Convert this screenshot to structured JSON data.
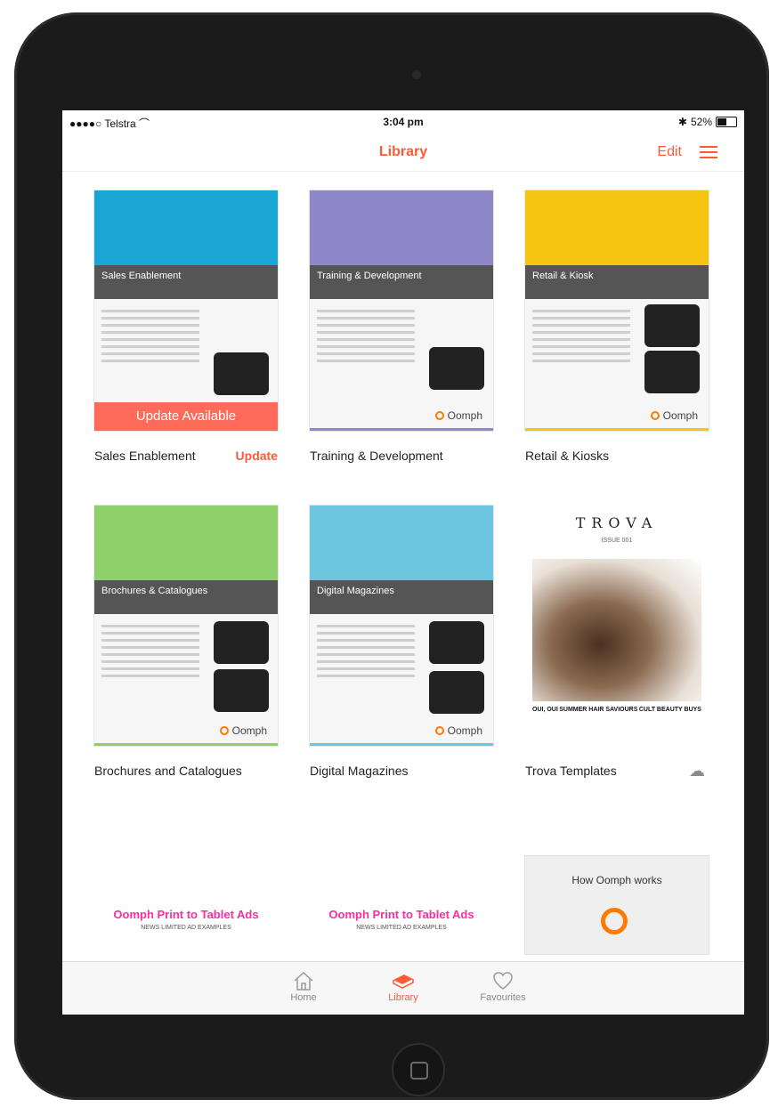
{
  "status": {
    "carrier": "●●●●○ Telstra",
    "wifi": "wifi-icon",
    "time": "3:04 pm",
    "battery": "52%"
  },
  "nav": {
    "title": "Library",
    "edit_label": "Edit",
    "menu_icon": "hamburger-menu-icon"
  },
  "library": {
    "items": [
      {
        "caption": "Sales Enablement",
        "thumb_title": "Sales Enablement",
        "overlay": "Update Available",
        "action": "Update"
      },
      {
        "caption": "Training & Development",
        "thumb_title": "Training & Development",
        "logo": "Oomph"
      },
      {
        "caption": "Retail & Kiosks",
        "thumb_title": "Retail & Kiosk",
        "logo": "Oomph"
      },
      {
        "caption": "Brochures and Catalogues",
        "thumb_title": "Brochures & Catalogues",
        "logo": "Oomph"
      },
      {
        "caption": "Digital Magazines",
        "thumb_title": "Digital Magazines",
        "logo": "Oomph"
      },
      {
        "caption": "Trova Templates",
        "thumb_title": "TROVA",
        "issue": "ISSUE 001",
        "icon": "cloud-download-icon",
        "cols": [
          "OUI, OUI",
          "SUMMER HAIR SAVIOURS",
          "CULT BEAUTY BUYS"
        ]
      }
    ],
    "ads": [
      {
        "title": "Oomph Print to Tablet Ads",
        "subtitle": "NEWS LIMITED AD EXAMPLES"
      },
      {
        "title": "Oomph Print to Tablet Ads",
        "subtitle": "NEWS LIMITED AD EXAMPLES"
      }
    ],
    "how": {
      "title": "How Oomph works"
    }
  },
  "tabbar": {
    "home": "Home",
    "library": "Library",
    "favourites": "Favourites"
  },
  "colors": {
    "accent": "#ff5a37",
    "ad_pink": "#ff2ca0"
  }
}
